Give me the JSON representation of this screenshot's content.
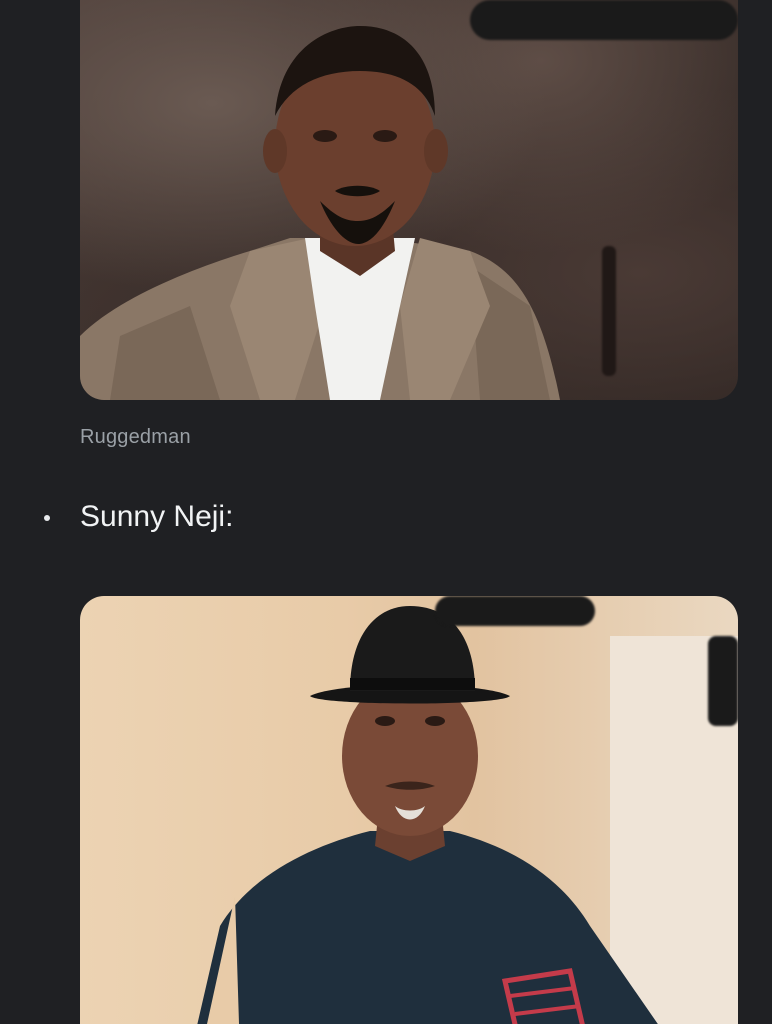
{
  "items": [
    {
      "image_alt": "Portrait of Ruggedman in a tan tweed blazer over a white shirt against a dark mottled backdrop",
      "caption": "Ruggedman"
    },
    {
      "bullet_label": "Sunny Neji:",
      "image_alt": "Portrait of Sunny Neji wearing a black fedora hat and a navy traditional outfit with red embroidery"
    }
  ]
}
